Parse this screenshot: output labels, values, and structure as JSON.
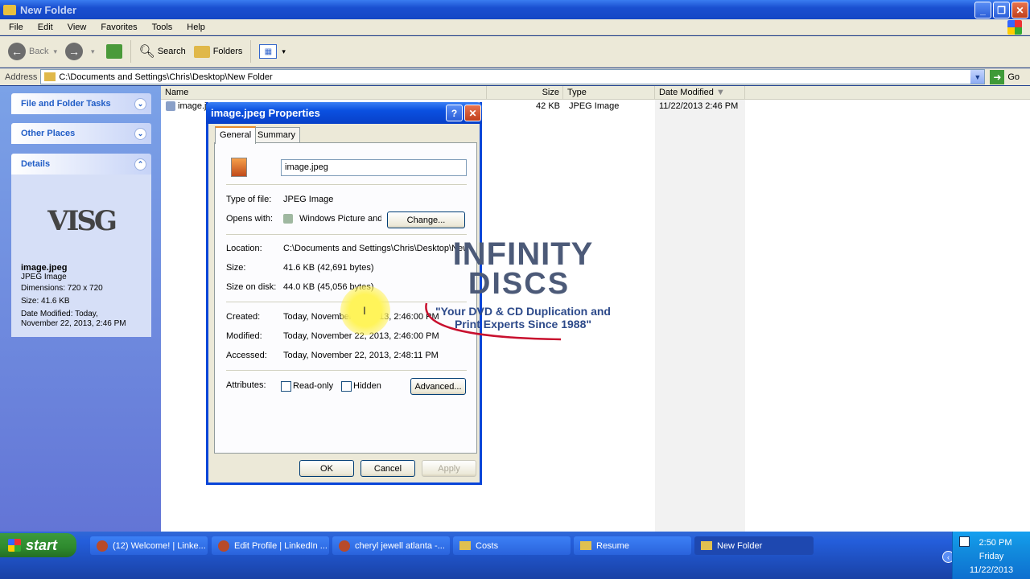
{
  "window": {
    "title": "New Folder"
  },
  "menu": [
    "File",
    "Edit",
    "View",
    "Favorites",
    "Tools",
    "Help"
  ],
  "toolbar": {
    "back": "Back",
    "search": "Search",
    "folders": "Folders"
  },
  "address": {
    "label": "Address",
    "value": "C:\\Documents and Settings\\Chris\\Desktop\\New Folder",
    "go": "Go"
  },
  "leftpane": {
    "tasks": "File and Folder Tasks",
    "other": "Other Places",
    "details": "Details",
    "thumb_text": "VISG",
    "file_name": "image.jpeg",
    "file_type": "JPEG Image",
    "dimensions": "Dimensions: 720 x 720",
    "size": "Size: 41.6 KB",
    "date_label": "Date Modified: Today,",
    "date_value": "November 22, 2013, 2:46 PM"
  },
  "columns": {
    "name": "Name",
    "size": "Size",
    "type": "Type",
    "date": "Date Modified"
  },
  "file_row": {
    "name": "image.jpeg",
    "size": "42 KB",
    "type": "JPEG Image",
    "date": "11/22/2013 2:46 PM"
  },
  "dialog": {
    "title": "image.jpeg Properties",
    "tabs": [
      "General",
      "Summary"
    ],
    "file_name": "image.jpeg",
    "type_label": "Type of file:",
    "type_value": "JPEG Image",
    "opens_label": "Opens with:",
    "opens_value": "Windows Picture and F",
    "change": "Change...",
    "location_label": "Location:",
    "location_value": "C:\\Documents and Settings\\Chris\\Desktop\\New F",
    "size_label": "Size:",
    "size_value": "41.6 KB (42,691 bytes)",
    "disk_label": "Size on disk:",
    "disk_value": "44.0 KB (45,056 bytes)",
    "created_label": "Created:",
    "created_value": "Today, November 22, 2013, 2:46:00 PM",
    "modified_label": "Modified:",
    "modified_value": "Today, November 22, 2013, 2:46:00 PM",
    "accessed_label": "Accessed:",
    "accessed_value": "Today, November 22, 2013, 2:48:11 PM",
    "attr_label": "Attributes:",
    "readonly": "Read-only",
    "hidden": "Hidden",
    "advanced": "Advanced...",
    "ok": "OK",
    "cancel": "Cancel",
    "apply": "Apply"
  },
  "watermark": {
    "line1": "INFINITY",
    "line2": "DISCS",
    "tagline1": "\"Your DVD & CD Duplication and",
    "tagline2": "Print Experts Since 1988\""
  },
  "taskbar": {
    "start": "start",
    "tasks": [
      "(12) Welcome! | Linke...",
      "Edit Profile | LinkedIn ...",
      "cheryl jewell atlanta -...",
      "Costs",
      "Resume",
      "New Folder"
    ],
    "time": "2:50 PM",
    "day": "Friday",
    "date": "11/22/2013"
  }
}
